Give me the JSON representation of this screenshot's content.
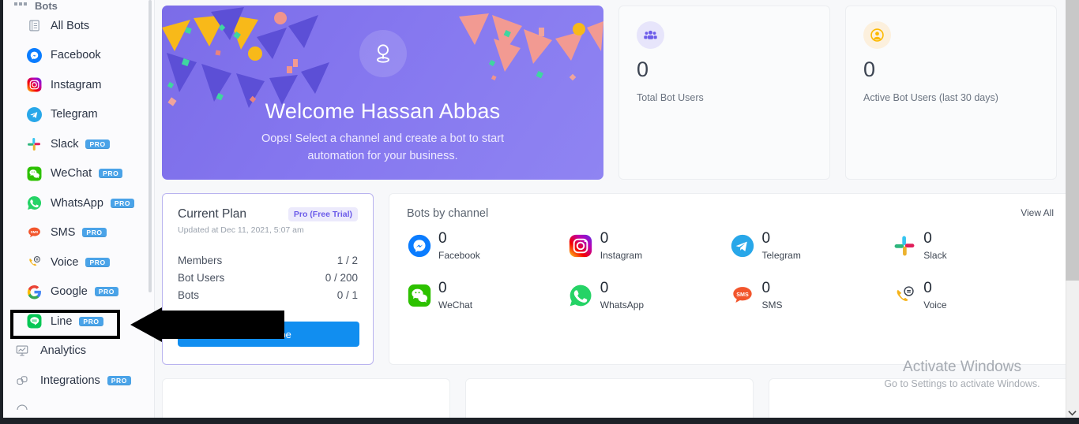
{
  "sidebar": {
    "group_title": "Bots",
    "items": [
      {
        "label": "All Bots",
        "icon": "list-icon",
        "pro": false
      },
      {
        "label": "Facebook",
        "icon": "messenger-icon",
        "pro": false
      },
      {
        "label": "Instagram",
        "icon": "instagram-icon",
        "pro": false
      },
      {
        "label": "Telegram",
        "icon": "telegram-icon",
        "pro": false
      },
      {
        "label": "Slack",
        "icon": "slack-icon",
        "pro": true,
        "pro_label": "PRO"
      },
      {
        "label": "WeChat",
        "icon": "wechat-icon",
        "pro": true,
        "pro_label": "PRO"
      },
      {
        "label": "WhatsApp",
        "icon": "whatsapp-icon",
        "pro": true,
        "pro_label": "PRO"
      },
      {
        "label": "SMS",
        "icon": "sms-icon",
        "pro": true,
        "pro_label": "PRO"
      },
      {
        "label": "Voice",
        "icon": "voice-icon",
        "pro": true,
        "pro_label": "PRO"
      },
      {
        "label": "Google",
        "icon": "google-icon",
        "pro": true,
        "pro_label": "PRO"
      },
      {
        "label": "Line",
        "icon": "line-icon",
        "pro": true,
        "pro_label": "PRO",
        "highlighted": true
      }
    ],
    "root_items": [
      {
        "label": "Analytics",
        "icon": "analytics-icon",
        "pro": false
      },
      {
        "label": "Integrations",
        "icon": "integrations-icon",
        "pro": true,
        "pro_label": "PRO"
      }
    ]
  },
  "banner": {
    "title": "Welcome Hassan Abbas",
    "subtitle": "Oops! Select a channel and create a bot to start automation for your business.",
    "avatar_icon": "user-pin-icon"
  },
  "stats": [
    {
      "value": "0",
      "label": "Total Bot Users",
      "icon": "users-group-icon",
      "tone": "purple"
    },
    {
      "value": "0",
      "label": "Active Bot Users (last 30 days)",
      "icon": "user-circle-icon",
      "tone": "amber"
    }
  ],
  "plan": {
    "title": "Current Plan",
    "badge": "Pro (Free Trial)",
    "updated": "Updated at Dec 11, 2021, 5:07 am",
    "rows": [
      {
        "label": "Members",
        "value": "1 / 2"
      },
      {
        "label": "Bot Users",
        "value": "0 / 200"
      },
      {
        "label": "Bots",
        "value": "0 / 1"
      }
    ],
    "subscribe_label": "Subscribe"
  },
  "channels": {
    "title": "Bots by channel",
    "view_all": "View All",
    "items": [
      {
        "count": "0",
        "name": "Facebook",
        "icon": "messenger-icon"
      },
      {
        "count": "0",
        "name": "Instagram",
        "icon": "instagram-icon"
      },
      {
        "count": "0",
        "name": "Telegram",
        "icon": "telegram-icon"
      },
      {
        "count": "0",
        "name": "Slack",
        "icon": "slack-icon"
      },
      {
        "count": "0",
        "name": "WeChat",
        "icon": "wechat-icon"
      },
      {
        "count": "0",
        "name": "WhatsApp",
        "icon": "whatsapp-icon"
      },
      {
        "count": "0",
        "name": "SMS",
        "icon": "sms-icon"
      },
      {
        "count": "0",
        "name": "Voice",
        "icon": "voice-icon"
      }
    ]
  },
  "watermark": {
    "line1": "Activate Windows",
    "line2": "Go to Settings to activate Windows."
  },
  "colors": {
    "brand_purple": "#7b6ce8",
    "subscribe_blue": "#118ef0",
    "pro_badge_blue": "#4aa3e8",
    "plan_badge_bg": "#eceafc",
    "plan_badge_text": "#6c5ce9"
  }
}
